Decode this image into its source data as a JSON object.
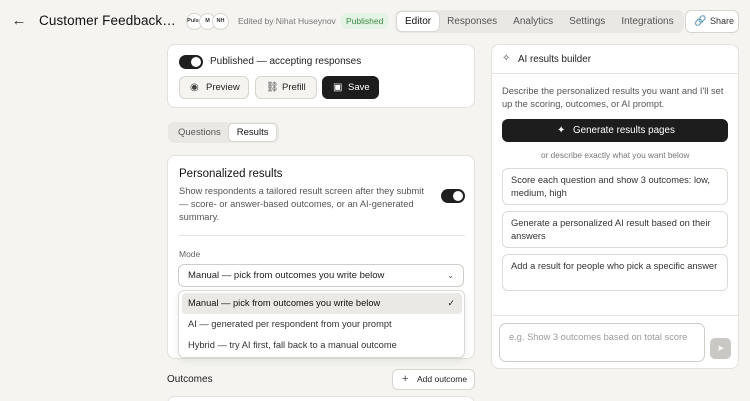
{
  "header": {
    "back_icon": "arrow-left-icon",
    "title": "Customer Feedback…",
    "avatars": [
      "Pulse",
      "M",
      "NH"
    ],
    "edited_by": "Edited by Nihat Huseynov",
    "status_badge": "Published",
    "tabs": [
      {
        "label": "Editor",
        "active": true
      },
      {
        "label": "Responses",
        "active": false
      },
      {
        "label": "Analytics",
        "active": false
      },
      {
        "label": "Settings",
        "active": false
      },
      {
        "label": "Integrations",
        "active": false
      }
    ],
    "share_label": "Share",
    "share_icon": "link-icon"
  },
  "publish_card": {
    "toggle_on": true,
    "status_text": "Published — accepting responses",
    "buttons": {
      "preview": {
        "label": "Preview",
        "icon": "eye-icon"
      },
      "prefill": {
        "label": "Prefill",
        "icon": "link-icon"
      },
      "save": {
        "label": "Save",
        "icon": "save-icon"
      }
    }
  },
  "segment": {
    "questions": "Questions",
    "results": "Results",
    "active": "Results"
  },
  "results_card": {
    "title": "Personalized results",
    "description": "Show respondents a tailored result screen after they submit — score- or answer-based outcomes, or an AI-generated summary.",
    "toggle_on": true,
    "mode_label": "Mode",
    "mode_selected": "Manual — pick from outcomes you write below",
    "mode_options": [
      {
        "label": "Manual — pick from outcomes you write below",
        "selected": true
      },
      {
        "label": "AI — generated per respondent from your prompt",
        "selected": false
      },
      {
        "label": "Hybrid — try AI first, fall back to a manual outcome",
        "selected": false
      }
    ]
  },
  "outcomes": {
    "title": "Outcomes",
    "add_label": "Add outcome"
  },
  "ai_panel": {
    "title": "AI results builder",
    "description": "Describe the personalized results you want and I'll set up the scoring, outcomes, or AI prompt.",
    "generate_label": "Generate results pages",
    "or_text": "or describe exactly what you want below",
    "suggestions": [
      "Score each question and show 3 outcomes: low, medium, high",
      "Generate a personalized AI result based on their answers",
      "Add a result for people who pick a specific answer"
    ],
    "input_placeholder": "e.g. Show 3 outcomes based on total score",
    "send_icon": "send-icon"
  },
  "colors": {
    "background": "#f5f4f1",
    "dark_button": "#1d1d1d",
    "published_badge_bg": "#e4f4e4",
    "published_badge_text": "#3c8a45"
  }
}
